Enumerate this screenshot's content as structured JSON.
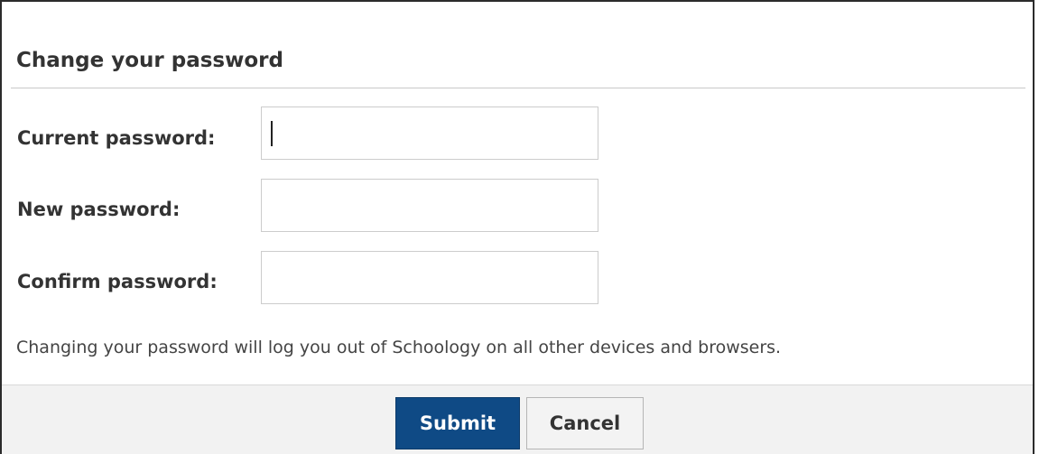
{
  "dialog": {
    "title": "Change your password",
    "fields": [
      {
        "label": "Current password:",
        "value": ""
      },
      {
        "label": "New password:",
        "value": ""
      },
      {
        "label": "Confirm password:",
        "value": ""
      }
    ],
    "note": "Changing your password will log you out of Schoology on all other devices and browsers.",
    "buttons": {
      "submit_label": "Submit",
      "cancel_label": "Cancel"
    },
    "colors": {
      "submit_bg": "#0f4a85",
      "footer_bg": "#f2f2f2"
    }
  }
}
